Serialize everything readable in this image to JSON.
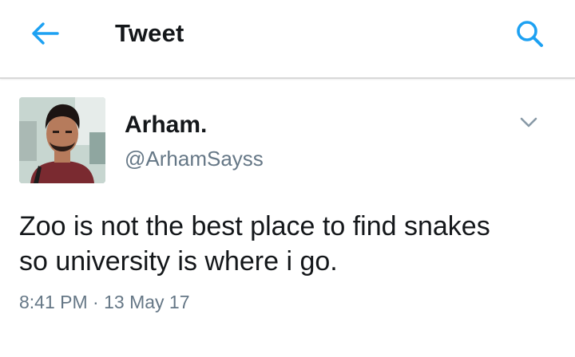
{
  "header": {
    "title": "Tweet",
    "back_icon": "arrow-left-icon",
    "search_icon": "search-icon",
    "accent_color": "#1da1f2"
  },
  "tweet": {
    "author_name": "Arham.",
    "author_handle": "@ArhamSayss",
    "text_line1": "Zoo is not the best place to find snakes",
    "text_line2": "so university is where i go.",
    "time": "8:41 PM",
    "separator": "·",
    "date": "13 May 17",
    "menu_icon": "chevron-down-icon"
  }
}
